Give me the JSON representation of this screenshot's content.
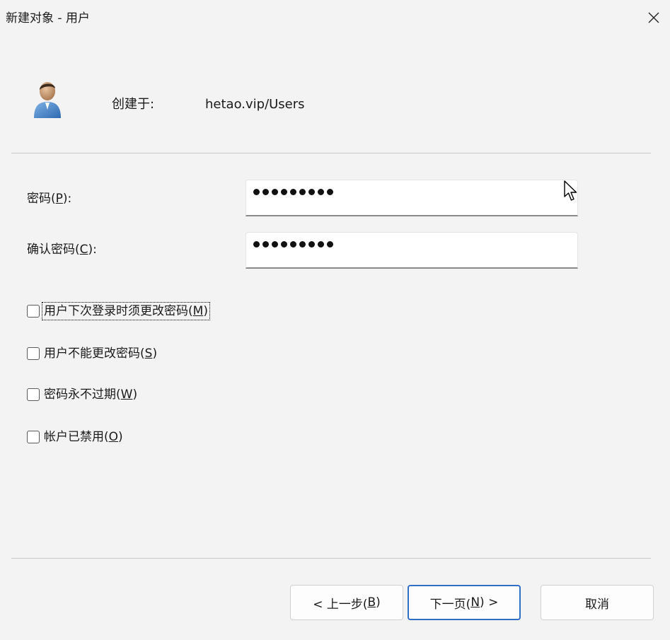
{
  "window": {
    "title": "新建对象 - 用户",
    "close_icon": "close-icon"
  },
  "header": {
    "created_in_label": "创建于:",
    "created_in_value": "hetao.vip/Users",
    "icon": "user-icon"
  },
  "form": {
    "password": {
      "label_prefix": "密码(",
      "accel": "P",
      "label_suffix": "):",
      "masked_length": 9
    },
    "confirm": {
      "label_prefix": "确认密码(",
      "accel": "C",
      "label_suffix": "):",
      "masked_length": 9
    }
  },
  "options": [
    {
      "prefix": "用户下次登录时须更改密码(",
      "accel": "M",
      "suffix": ")",
      "checked": false,
      "focused": true
    },
    {
      "prefix": "用户不能更改密码(",
      "accel": "S",
      "suffix": ")",
      "checked": false,
      "focused": false
    },
    {
      "prefix": "密码永不过期(",
      "accel": "W",
      "suffix": ")",
      "checked": false,
      "focused": false
    },
    {
      "prefix": "帐户已禁用(",
      "accel": "O",
      "suffix": ")",
      "checked": false,
      "focused": false
    }
  ],
  "buttons": {
    "back": {
      "prefix": "< 上一步(",
      "accel": "B",
      "suffix": ")"
    },
    "next": {
      "prefix": "下一页(",
      "accel": "N",
      "suffix": ") >"
    },
    "cancel": {
      "label": "取消"
    }
  },
  "colors": {
    "accent": "#2f6fc4",
    "background": "#f3f3f3"
  }
}
